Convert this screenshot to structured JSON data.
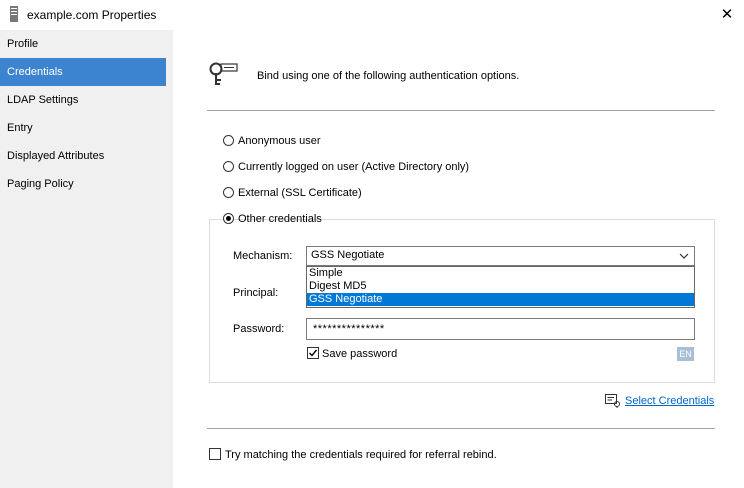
{
  "window": {
    "title": "example.com Properties",
    "close_label": "✕"
  },
  "sidebar": {
    "items": [
      {
        "label": "Profile"
      },
      {
        "label": "Credentials"
      },
      {
        "label": "LDAP Settings"
      },
      {
        "label": "Entry"
      },
      {
        "label": "Displayed Attributes"
      },
      {
        "label": "Paging Policy"
      }
    ],
    "selected": "Credentials"
  },
  "main": {
    "header_text": "Bind using one of the following authentication options.",
    "options": [
      {
        "label": "Anonymous user",
        "checked": false
      },
      {
        "label": "Currently logged on user (Active Directory only)",
        "checked": false
      },
      {
        "label": "External (SSL Certificate)",
        "checked": false
      },
      {
        "label": "Other credentials",
        "checked": true
      }
    ],
    "mechanism_label": "Mechanism:",
    "mechanism_value": "GSS Negotiate",
    "mechanism_options": [
      "Simple",
      "Digest MD5",
      "GSS Negotiate"
    ],
    "principal_label": "Principal:",
    "password_label": "Password:",
    "password_value": "***************",
    "save_password_label": "Save password",
    "save_password_checked": true,
    "lang_badge": "EN",
    "select_credentials_label": "Select Credentials",
    "referral_label": "Try matching the credentials required for referral rebind.",
    "referral_checked": false
  },
  "colors": {
    "accent": "#0078d7",
    "sidebar_selected": "#3c84d0",
    "link": "#0066cc"
  }
}
